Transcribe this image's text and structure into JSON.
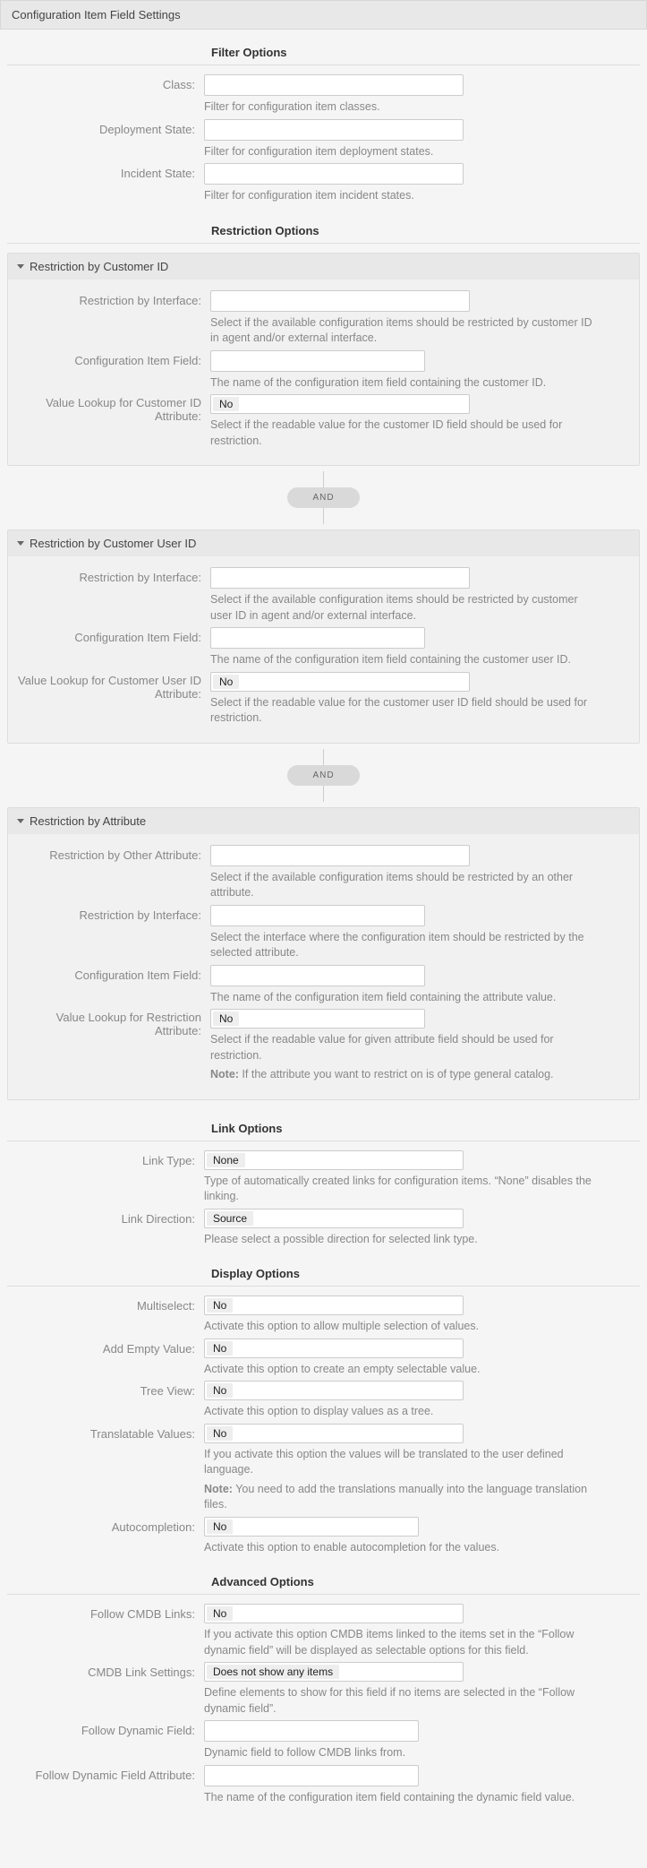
{
  "header": {
    "title": "Configuration Item Field Settings"
  },
  "sections": {
    "filter": "Filter Options",
    "restriction": "Restriction Options",
    "link": "Link Options",
    "display": "Display Options",
    "advanced": "Advanced Options"
  },
  "filter": {
    "class": {
      "label": "Class:",
      "hint": "Filter for configuration item classes."
    },
    "deployment": {
      "label": "Deployment State:",
      "hint": "Filter for configuration item deployment states."
    },
    "incident": {
      "label": "Incident State:",
      "hint": "Filter for configuration item incident states."
    }
  },
  "connector": {
    "label": "AND"
  },
  "restr_customer": {
    "title": "Restriction by Customer ID",
    "iface": {
      "label": "Restriction by Interface:",
      "hint": "Select if the available configuration items should be restricted by customer ID in agent and/or external interface."
    },
    "cifield": {
      "label": "Configuration Item Field:",
      "hint": "The name of the configuration item field containing the customer ID."
    },
    "lookup": {
      "label1": "Value Lookup for Customer ID",
      "label2": "Attribute:",
      "value": "No",
      "hint": "Select if the readable value for the customer ID field should be used for restriction."
    }
  },
  "restr_user": {
    "title": "Restriction by Customer User ID",
    "iface": {
      "label": "Restriction by Interface:",
      "hint": "Select if the available configuration items should be restricted by customer user ID in agent and/or external interface."
    },
    "cifield": {
      "label": "Configuration Item Field:",
      "hint": "The name of the configuration item field containing the customer user ID."
    },
    "lookup": {
      "label1": "Value Lookup for Customer User ID",
      "label2": "Attribute:",
      "value": "No",
      "hint": "Select if the readable value for the customer user ID field should be used for restriction."
    }
  },
  "restr_attr": {
    "title": "Restriction by Attribute",
    "other": {
      "label": "Restriction by Other Attribute:",
      "hint": "Select if the available configuration items should be restricted by an other attribute."
    },
    "iface": {
      "label": "Restriction by Interface:",
      "hint": "Select the interface where the configuration item should be restricted by the selected attribute."
    },
    "cifield": {
      "label": "Configuration Item Field:",
      "hint": "The name of the configuration item field containing the attribute value."
    },
    "lookup": {
      "label1": "Value Lookup for Restriction",
      "label2": "Attribute:",
      "value": "No",
      "hint": "Select if the readable value for given attribute field should be used for restriction.",
      "note_label": "Note:",
      "note": " If the attribute you want to restrict on is of type general catalog."
    }
  },
  "link": {
    "type": {
      "label": "Link Type:",
      "value": "None",
      "hint": "Type of automatically created links for configuration items. “None” disables the linking."
    },
    "direction": {
      "label": "Link Direction:",
      "value": "Source",
      "hint": "Please select a possible direction for selected link type."
    }
  },
  "display": {
    "multi": {
      "label": "Multiselect:",
      "value": "No",
      "hint": "Activate this option to allow multiple selection of values."
    },
    "empty": {
      "label": "Add Empty Value:",
      "value": "No",
      "hint": "Activate this option to create an empty selectable value."
    },
    "tree": {
      "label": "Tree View:",
      "value": "No",
      "hint": "Activate this option to display values as a tree."
    },
    "trans": {
      "label": "Translatable Values:",
      "value": "No",
      "hint": "If you activate this option the values will be translated to the user defined language.",
      "note_label": "Note:",
      "note": " You need to add the translations manually into the language translation files."
    },
    "auto": {
      "label": "Autocompletion:",
      "value": "No",
      "hint": "Activate this option to enable autocompletion for the values."
    }
  },
  "advanced": {
    "follow": {
      "label": "Follow CMDB Links:",
      "value": "No",
      "hint": "If you activate this option CMDB items linked to the items set in the “Follow dynamic field” will be displayed as selectable options for this field."
    },
    "linkset": {
      "label": "CMDB Link Settings:",
      "value": "Does not show any items",
      "hint": "Define elements to show for this field if no items are selected in the “Follow dynamic field”."
    },
    "followdyn": {
      "label": "Follow Dynamic Field:",
      "hint": "Dynamic field to follow CMDB links from."
    },
    "followattr": {
      "label": "Follow Dynamic Field Attribute:",
      "hint": "The name of the configuration item field containing the dynamic field value."
    }
  }
}
